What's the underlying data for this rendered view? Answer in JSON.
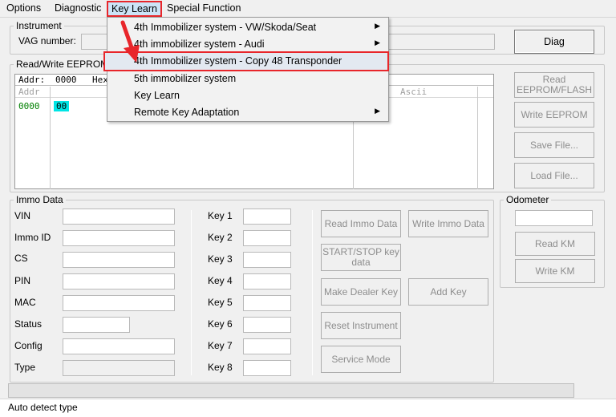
{
  "menubar": {
    "items": [
      "Options",
      "Diagnostic",
      "Key Learn",
      "Special Function"
    ]
  },
  "dropdown": {
    "items": [
      {
        "label": "4th Immobilizer system - VW/Skoda/Seat",
        "submenu": true
      },
      {
        "label": "4th immobilizer system - Audi",
        "submenu": true
      },
      {
        "label": "4th Immobilizer system - Copy 48 Transponder",
        "submenu": false
      },
      {
        "label": "5th immobilizer system",
        "submenu": false
      },
      {
        "label": "Key Learn",
        "submenu": false
      },
      {
        "label": "Remote Key Adaptation",
        "submenu": true
      }
    ],
    "arrow": "▶"
  },
  "instrument": {
    "legend": "Instrument",
    "vag_label": "VAG number:",
    "diag_button": "Diag"
  },
  "eeprom": {
    "legend": "Read/Write EEPROM",
    "addr_label": "Addr:",
    "addr_value": "0000",
    "hex_label": "Hex",
    "col_addr": "Addr",
    "col_ascii": "Ascii",
    "row_addr": "0000",
    "row_value": "00",
    "buttons": {
      "read": "Read EEPROM/FLASH",
      "write": "Write EEPROM",
      "save": "Save File...",
      "load": "Load File..."
    }
  },
  "immo": {
    "legend": "Immo Data",
    "fields": [
      "VIN",
      "Immo ID",
      "CS",
      "PIN",
      "MAC",
      "Status",
      "Config",
      "Type"
    ],
    "keys": [
      "Key 1",
      "Key 2",
      "Key 3",
      "Key 4",
      "Key 5",
      "Key 6",
      "Key 7",
      "Key 8"
    ],
    "buttons": {
      "read_immo": "Read Immo Data",
      "write_immo": "Write Immo Data",
      "start_stop": "START/STOP key data",
      "make_dealer": "Make Dealer Key",
      "add_key": "Add Key",
      "reset_instrument": "Reset Instrument",
      "service_mode": "Service Mode"
    }
  },
  "odometer": {
    "legend": "Odometer",
    "read_km": "Read KM",
    "write_km": "Write KM"
  },
  "status_bar": {
    "text": "Auto detect type"
  },
  "colors": {
    "highlight_red": "#e8262b",
    "selected_cell": "#00e5e5",
    "addr_green": "#008000"
  }
}
